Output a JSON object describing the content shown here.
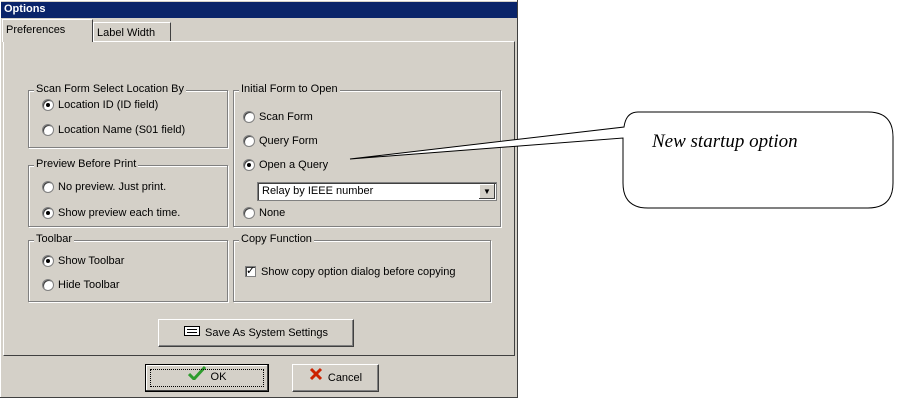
{
  "window": {
    "title": "Options"
  },
  "tabs": [
    {
      "label": "Preferences",
      "active": true
    },
    {
      "label": "Label Width",
      "active": false
    }
  ],
  "scan_form_group": {
    "legend": "Scan Form Select Location By",
    "options": [
      {
        "label": "Location ID (ID field)",
        "selected": true
      },
      {
        "label": "Location Name  (S01 field)",
        "selected": false
      }
    ]
  },
  "preview_group": {
    "legend": "Preview Before Print",
    "options": [
      {
        "label": "No preview. Just print.",
        "selected": false
      },
      {
        "label": "Show preview each time.",
        "selected": true
      }
    ]
  },
  "toolbar_group": {
    "legend": "Toolbar",
    "options": [
      {
        "label": "Show Toolbar",
        "selected": true
      },
      {
        "label": "Hide Toolbar",
        "selected": false
      }
    ]
  },
  "initial_form_group": {
    "legend": "Initial Form to Open",
    "options": [
      {
        "label": "Scan Form",
        "selected": false
      },
      {
        "label": "Query Form",
        "selected": false
      },
      {
        "label": "Open a Query",
        "selected": true
      },
      {
        "label": "None",
        "selected": false
      }
    ],
    "query_select": {
      "value": "Relay by IEEE number"
    }
  },
  "copy_group": {
    "legend": "Copy Function",
    "checkbox": {
      "label": "Show copy option dialog before copying",
      "checked": true
    }
  },
  "buttons": {
    "save_system": "Save As System Settings",
    "ok": "OK",
    "cancel": "Cancel"
  },
  "callout": {
    "text": "New startup option"
  },
  "colors": {
    "titlebar": "#0a246a",
    "face": "#d4d0c8",
    "ok_check": "#2e9c2e",
    "cancel_x": "#cc2200"
  }
}
